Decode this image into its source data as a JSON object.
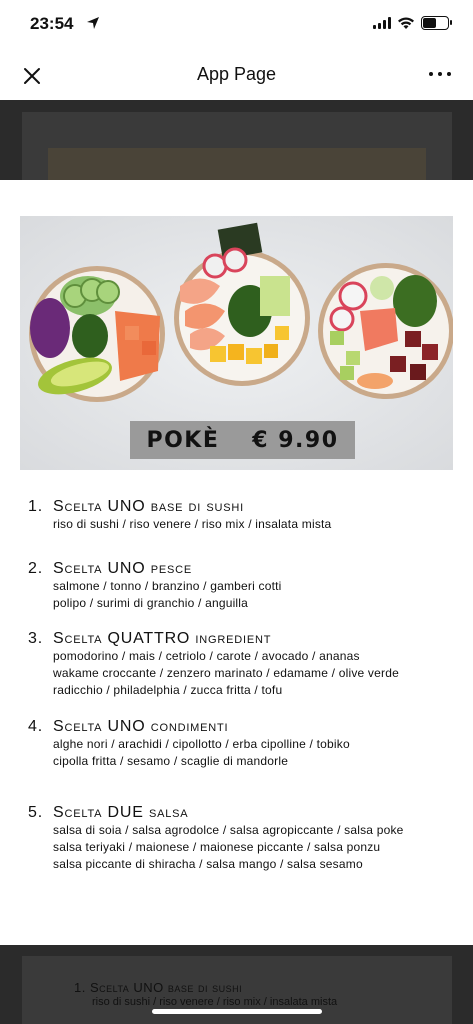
{
  "status_bar": {
    "time": "23:54"
  },
  "nav": {
    "title": "App Page"
  },
  "hero": {
    "label": "POKÈ",
    "price": "€ 9.90"
  },
  "menu": {
    "steps": [
      {
        "num": "1.",
        "title": "Scelta UNO base di sushi",
        "lines": [
          "riso di sushi / riso venere / riso mix / insalata mista"
        ]
      },
      {
        "num": "2.",
        "title": "Scelta UNO pesce",
        "lines": [
          "salmone / tonno / branzino / gamberi cotti",
          "polipo / surimi di granchio / anguilla"
        ]
      },
      {
        "num": "3.",
        "title": "Scelta QUATTRO ingredient",
        "lines": [
          "pomodorino / mais / cetriolo / carote / avocado / ananas",
          "wakame croccante / zenzero marinato / edamame / olive verde",
          "radicchio / philadelphia / zucca fritta / tofu"
        ]
      },
      {
        "num": "4.",
        "title": "Scelta UNO condimenti",
        "lines": [
          "alghe nori / arachidi / cipollotto / erba cipolline / tobiko",
          "cipolla fritta / sesamo / scaglie di mandorle"
        ]
      },
      {
        "num": "5.",
        "title": "Scelta DUE salsa",
        "lines": [
          "salsa di soia / salsa agrodolce / salsa agropiccante / salsa poke",
          "salsa teriyaki / maionese / maionese piccante / salsa ponzu",
          "salsa piccante di shiracha / salsa mango / salsa sesamo"
        ]
      }
    ]
  },
  "background_page": {
    "step_title": "1. Scelta UNO base di sushi",
    "step_line": "riso di sushi / riso venere / riso mix / insalata mista"
  }
}
